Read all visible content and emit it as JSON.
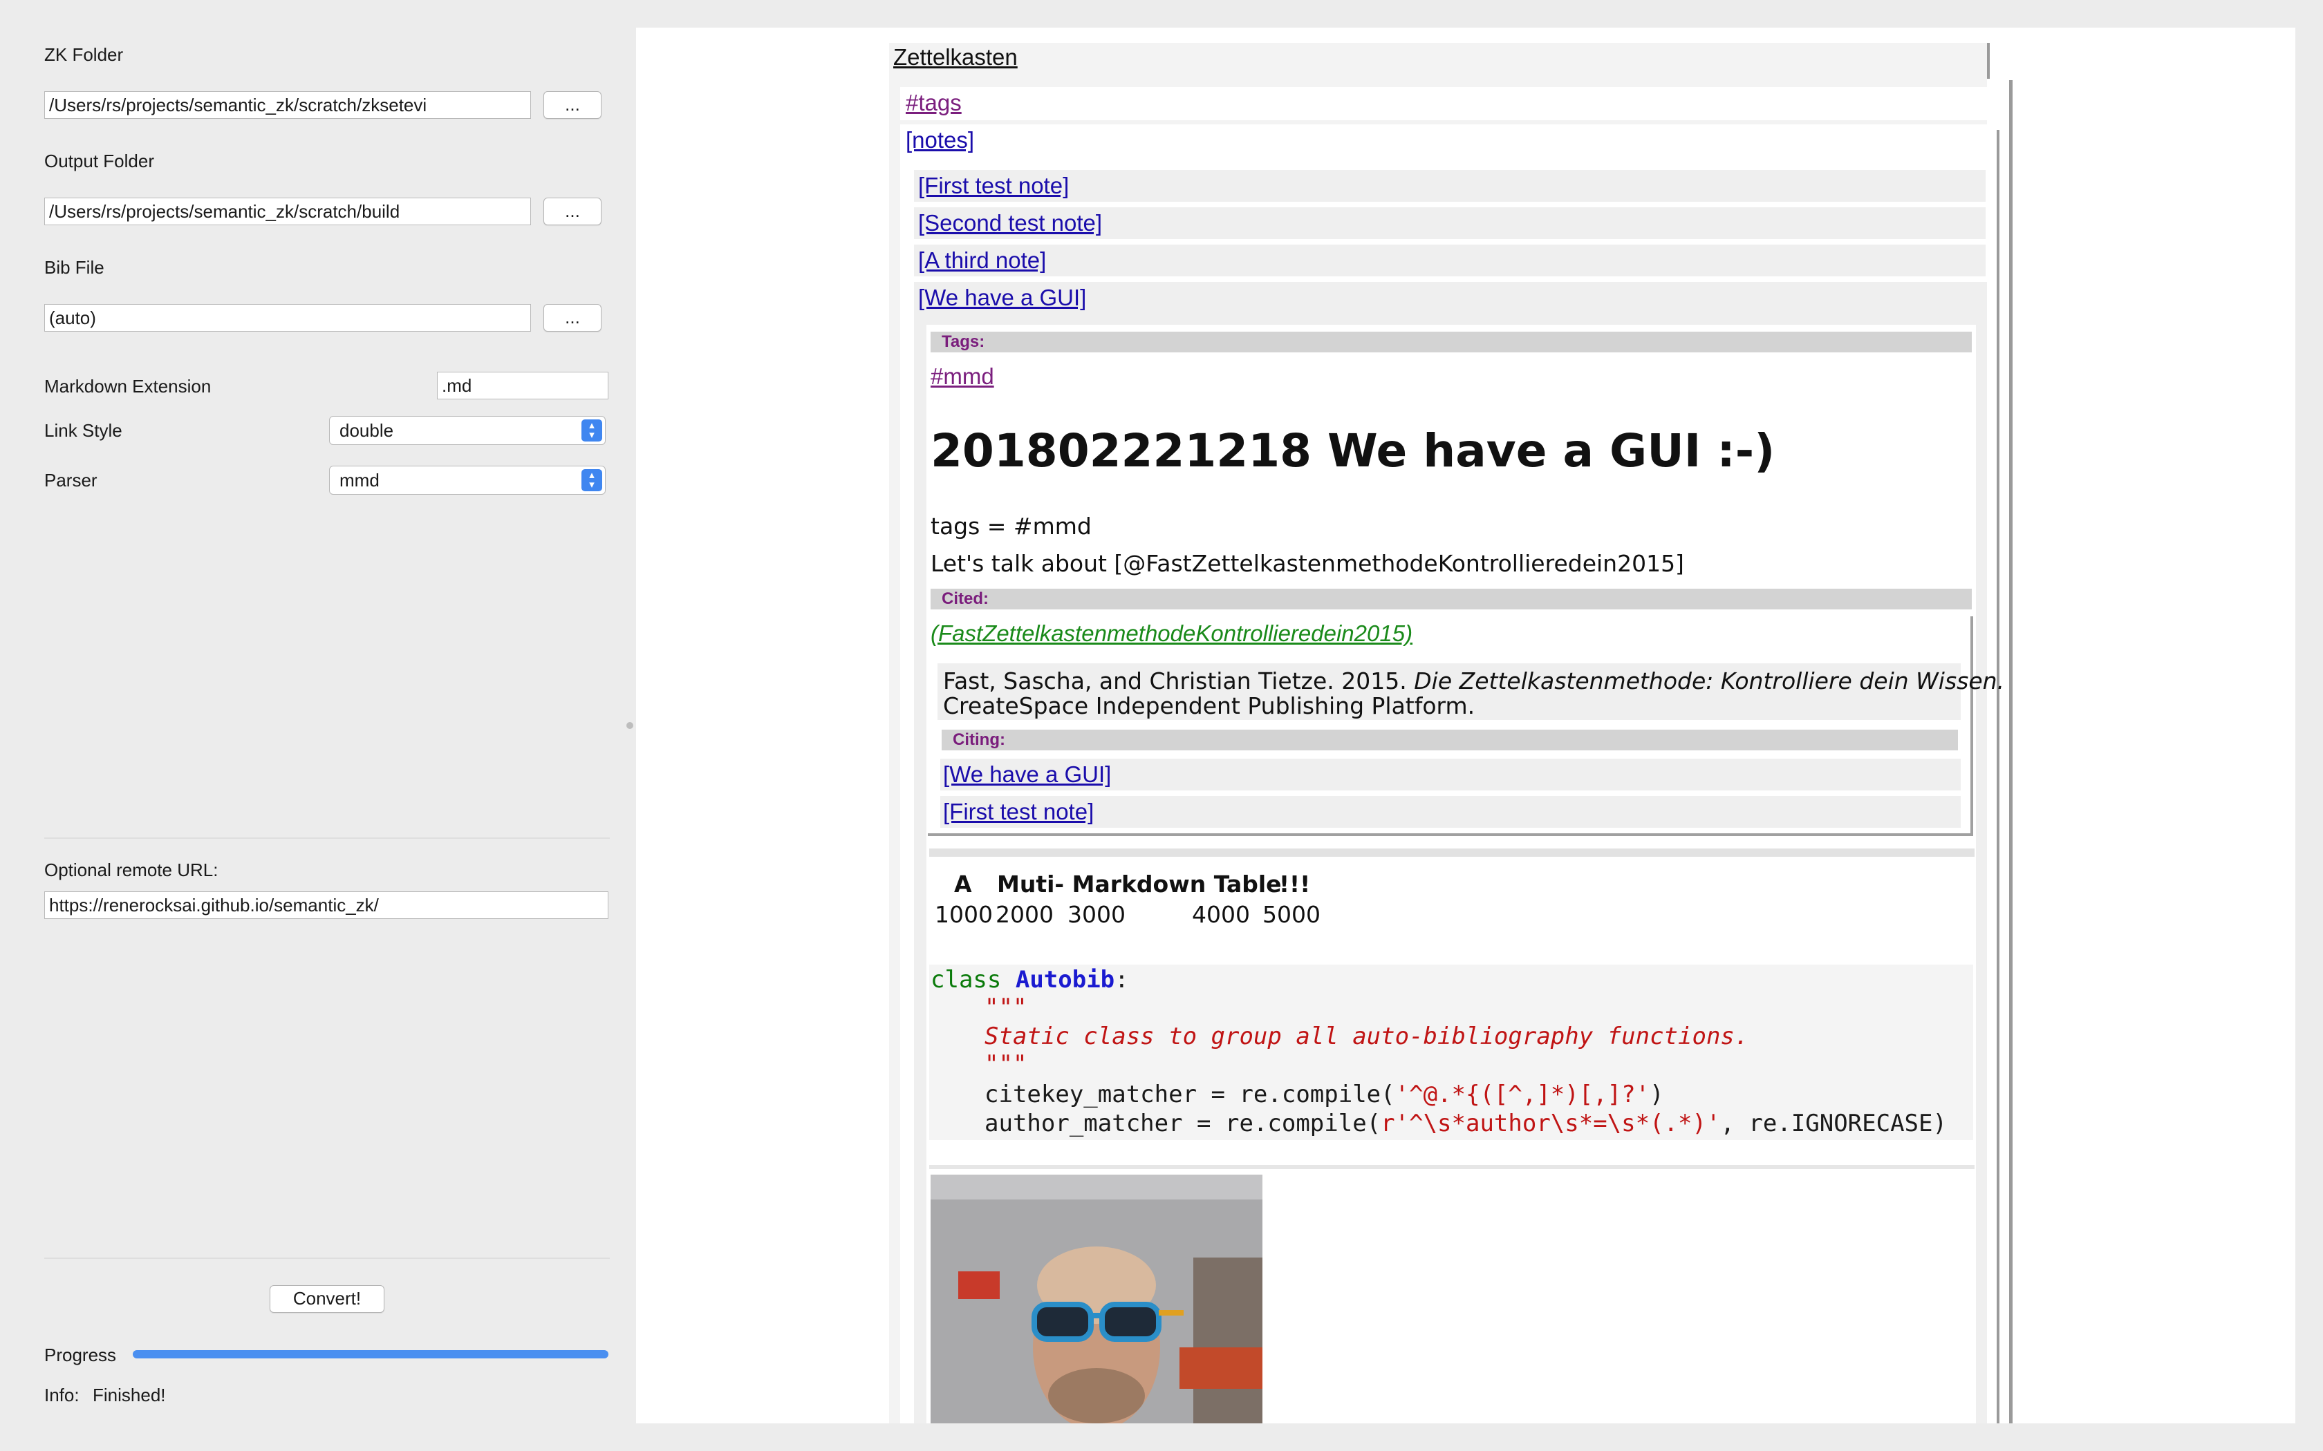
{
  "form": {
    "zk_folder_label": "ZK Folder",
    "zk_folder_value": "/Users/rs/projects/semantic_zk/scratch/zksetevi",
    "output_folder_label": "Output Folder",
    "output_folder_value": "/Users/rs/projects/semantic_zk/scratch/build",
    "bib_file_label": "Bib File",
    "bib_file_value": "(auto)",
    "browse_label": "...",
    "markdown_ext_label": "Markdown Extension",
    "markdown_ext_value": ".md",
    "link_style_label": "Link Style",
    "link_style_value": "double",
    "parser_label": "Parser",
    "parser_value": "mmd",
    "remote_url_label": "Optional remote URL:",
    "remote_url_value": "https://renerocksai.github.io/semantic_zk/",
    "convert_label": "Convert!",
    "progress_label": "Progress",
    "progress_fraction": 1.0,
    "info_label": "Info:",
    "info_value": "Finished!"
  },
  "web": {
    "root_title": "Zettelkasten",
    "tags_link": "#tags",
    "notes_link": "[notes]",
    "notes": [
      "[First test note]",
      "[Second test note]",
      "[A third note]",
      "[We have a GUI]"
    ],
    "tags_band": "Tags:",
    "tag_mmd": "#mmd",
    "heading": "201802221218 We have a GUI :-)",
    "tags_line": "tags = #mmd",
    "talk_line": "Let's talk about [@FastZettelkastenmethodeKontrollieredein2015]",
    "cited_band": "Cited:",
    "citekey_link": "(FastZettelkastenmethodeKontrollieredein2015)",
    "ref_prefix": "Fast, Sascha, and Christian Tietze. 2015. ",
    "ref_title": "Die Zettelkastenmethode: Kontrolliere dein Wissen.",
    "ref_line2": "CreateSpace Independent Publishing Platform.",
    "citing_band": "Citing:",
    "citing_links": [
      "[We have a GUI]",
      "[First test note]"
    ],
    "table": {
      "headers": [
        "A",
        "Muti- Markdown Table",
        "!!!"
      ],
      "row": [
        "1000",
        "2000",
        "3000",
        "4000",
        "5000"
      ]
    },
    "code": {
      "kw_class": "class",
      "class_name": "Autobib",
      "colon": ":",
      "doc_quote": "\"\"\"",
      "doc_text": "Static class to group all auto-bibliography functions.",
      "line1_pre": "citekey_matcher = re.compile(",
      "line1_str": "'^@.*{([^,]*)[,]?'",
      "line1_post": ")",
      "line2_pre": "author_matcher = re.compile(",
      "line2_str": "r'^\\s*author\\s*=\\s*(.*)'",
      "line2_post": ", re.IGNORECASE)"
    }
  }
}
